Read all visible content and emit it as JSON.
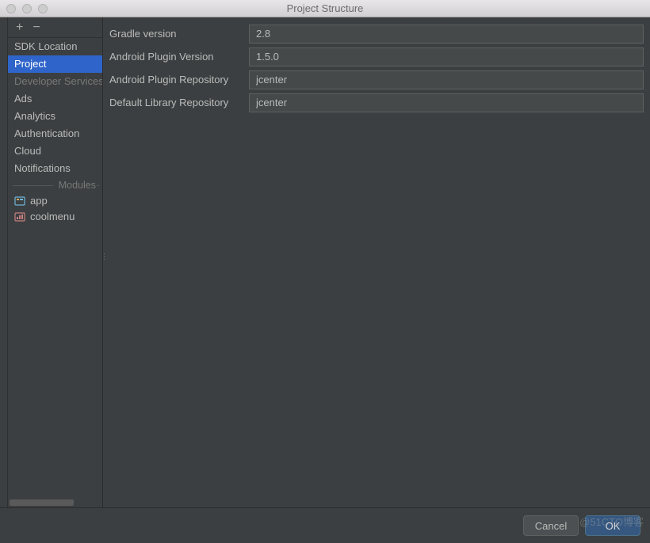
{
  "window": {
    "title": "Project Structure"
  },
  "toolbar": {
    "add_label": "+",
    "remove_label": "−"
  },
  "sidebar": {
    "items": [
      {
        "label": "SDK Location",
        "selected": false
      },
      {
        "label": "Project",
        "selected": true
      }
    ],
    "dev_services_header": "Developer Services",
    "dev_services": [
      {
        "label": "Ads"
      },
      {
        "label": "Analytics"
      },
      {
        "label": "Authentication"
      },
      {
        "label": "Cloud"
      },
      {
        "label": "Notifications"
      }
    ],
    "modules_header": "Modules",
    "modules": [
      {
        "label": "app",
        "icon": "module-app-icon"
      },
      {
        "label": "coolmenu",
        "icon": "module-lib-icon"
      }
    ]
  },
  "form": {
    "gradle_version": {
      "label": "Gradle version",
      "value": "2.8"
    },
    "android_plugin_version": {
      "label": "Android Plugin Version",
      "value": "1.5.0"
    },
    "android_plugin_repo": {
      "label": "Android Plugin Repository",
      "value": "jcenter"
    },
    "default_library_repo": {
      "label": "Default Library Repository",
      "value": "jcenter"
    }
  },
  "buttons": {
    "cancel": "Cancel",
    "ok": "OK"
  },
  "watermark": "@51CTO博客"
}
